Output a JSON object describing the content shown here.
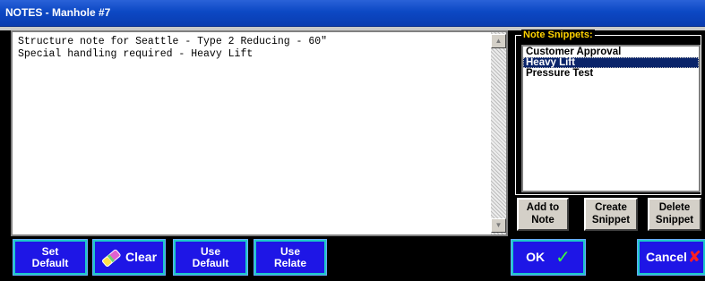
{
  "window": {
    "title": "NOTES - Manhole #7"
  },
  "notes": {
    "lines": [
      "Structure note for Seattle - Type 2 Reducing - 60\"",
      "Special handling required - Heavy Lift"
    ]
  },
  "snippets": {
    "legend": "Note Snippets:",
    "items": [
      {
        "label": "Customer Approval",
        "selected": false
      },
      {
        "label": "Heavy Lift",
        "selected": true
      },
      {
        "label": "Pressure Test",
        "selected": false
      }
    ],
    "add_to_note": {
      "line1": "Add to",
      "line2": "Note"
    },
    "create_snippet": {
      "line1": "Create",
      "line2": "Snippet"
    },
    "delete_snippet": {
      "line1": "Delete",
      "line2": "Snippet"
    }
  },
  "toolbar": {
    "set_default": {
      "line1": "Set",
      "line2": "Default"
    },
    "clear": "Clear",
    "use_default": {
      "line1": "Use",
      "line2": "Default"
    },
    "use_relate": {
      "line1": "Use",
      "line2": "Relate"
    },
    "ok": "OK",
    "ok_check": "✓",
    "cancel": "Cancel",
    "cancel_x": "✘"
  },
  "colors": {
    "button_blue": "#1e16e6",
    "button_border": "#1dc9c9",
    "legend_yellow": "#ffd200",
    "selection": "#0a246a"
  },
  "icons": {
    "clear_button": "eraser-icon",
    "ok_button": "checkmark-icon",
    "cancel_button": "x-mark-icon"
  }
}
